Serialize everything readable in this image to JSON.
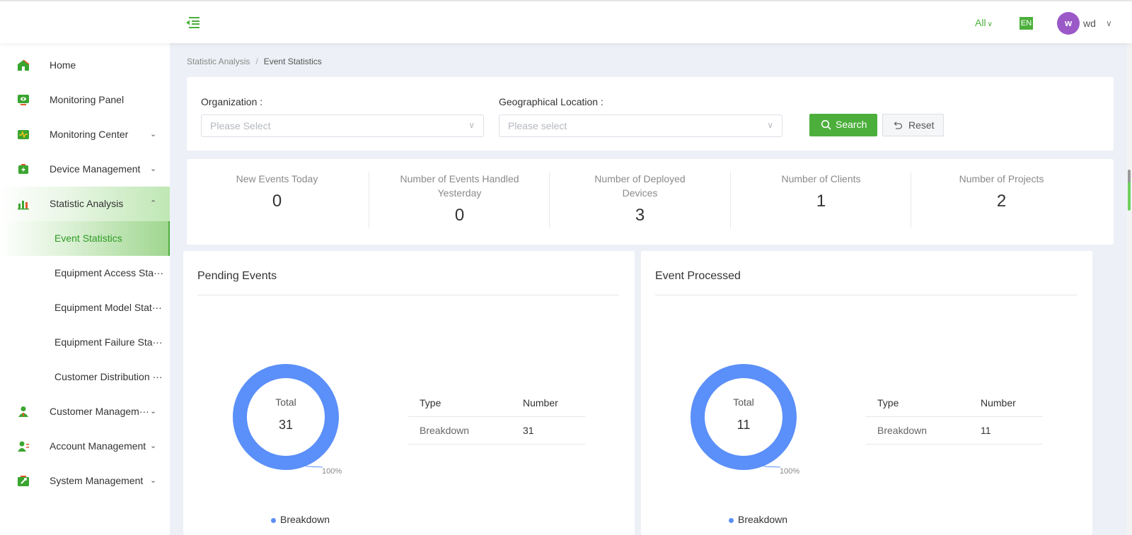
{
  "topbar": {
    "scope_label": "All",
    "language": "EN",
    "avatar_initial": "w",
    "username": "wd"
  },
  "sidebar": {
    "items": [
      {
        "label": "Home",
        "icon": "home-icon"
      },
      {
        "label": "Monitoring Panel",
        "icon": "monitor-icon"
      },
      {
        "label": "Monitoring Center",
        "icon": "monitor-center-icon"
      },
      {
        "label": "Device Management",
        "icon": "battery-icon"
      },
      {
        "label": "Statistic Analysis",
        "icon": "bar-chart-icon"
      },
      {
        "label": "Customer Managem···",
        "icon": "customer-icon"
      },
      {
        "label": "Account Management",
        "icon": "account-icon"
      },
      {
        "label": "System Management",
        "icon": "wrench-icon"
      }
    ],
    "sub_items": [
      {
        "label": "Event Statistics"
      },
      {
        "label": "Equipment Access Sta···"
      },
      {
        "label": "Equipment Model Stat···"
      },
      {
        "label": "Equipment Failure Sta···"
      },
      {
        "label": "Customer Distribution ···"
      }
    ]
  },
  "breadcrumb": {
    "parent": "Statistic Analysis",
    "separator": "/",
    "current": "Event Statistics"
  },
  "filters": {
    "organization_label": "Organization :",
    "organization_placeholder": "Please Select",
    "location_label": "Geographical Location :",
    "location_placeholder": "Please select",
    "search_label": "Search",
    "reset_label": "Reset"
  },
  "stats": [
    {
      "title": "New Events Today",
      "value": "0"
    },
    {
      "title": "Number of Events Handled Yesterday",
      "value": "0"
    },
    {
      "title": "Number of Deployed Devices",
      "value": "3"
    },
    {
      "title": "Number of Clients",
      "value": "1"
    },
    {
      "title": "Number of Projects",
      "value": "2"
    }
  ],
  "panels": [
    {
      "title": "Pending Events",
      "total_label": "Total",
      "total": "31",
      "percent_label": "100%",
      "legend": "Breakdown",
      "table_headers": [
        "Type",
        "Number"
      ],
      "rows": [
        {
          "type": "Breakdown",
          "number": "31"
        }
      ]
    },
    {
      "title": "Event Processed",
      "total_label": "Total",
      "total": "11",
      "percent_label": "100%",
      "legend": "Breakdown",
      "table_headers": [
        "Type",
        "Number"
      ],
      "rows": [
        {
          "type": "Breakdown",
          "number": "11"
        }
      ]
    }
  ],
  "colors": {
    "brand_green": "#4caf3c",
    "donut_blue": "#5b8ff9",
    "avatar_purple": "#9b59c8",
    "page_bg": "#edf0f6"
  }
}
